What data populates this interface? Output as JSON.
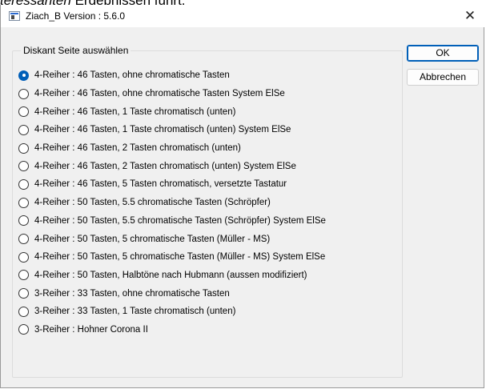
{
  "background": {
    "italic_text": "teressanten",
    "text": " Ergebnissen führt."
  },
  "window": {
    "title": "Ziach_B  Version : 5.6.0",
    "close_glyph": "✕",
    "icon": "app-window-icon"
  },
  "group": {
    "label": "Diskant Seite auswählen",
    "selected_index": 0,
    "options": [
      "4-Reiher : 46 Tasten, ohne chromatische Tasten",
      "4-Reiher : 46 Tasten, ohne chromatische Tasten System ElSe",
      "4-Reiher : 46 Tasten, 1 Taste chromatisch (unten)",
      "4-Reiher : 46 Tasten, 1 Taste chromatisch (unten) System ElSe",
      "4-Reiher : 46 Tasten, 2 Tasten chromatisch (unten)",
      "4-Reiher : 46 Tasten, 2 Tasten chromatisch (unten) System ElSe",
      "4-Reiher : 46 Tasten, 5 Tasten chromatisch, versetzte Tastatur",
      "4-Reiher : 50 Tasten, 5.5 chromatische Tasten (Schröpfer)",
      "4-Reiher : 50 Tasten, 5.5 chromatische Tasten (Schröpfer)  System ElSe",
      "4-Reiher : 50 Tasten, 5 chromatische Tasten (Müller - MS)",
      "4-Reiher : 50 Tasten, 5 chromatische Tasten (Müller - MS) System ElSe",
      "4-Reiher : 50 Tasten, Halbtöne nach Hubmann (aussen modifiziert)",
      "3-Reiher : 33 Tasten, ohne chromatische Tasten",
      "3-Reiher : 33 Tasten, 1 Taste chromatisch (unten)",
      "3-Reiher : Hohner Corona II"
    ]
  },
  "buttons": {
    "ok": "OK",
    "cancel": "Abbrechen"
  },
  "colors": {
    "accent": "#005fb8",
    "dialog_bg": "#f0f0f0"
  }
}
